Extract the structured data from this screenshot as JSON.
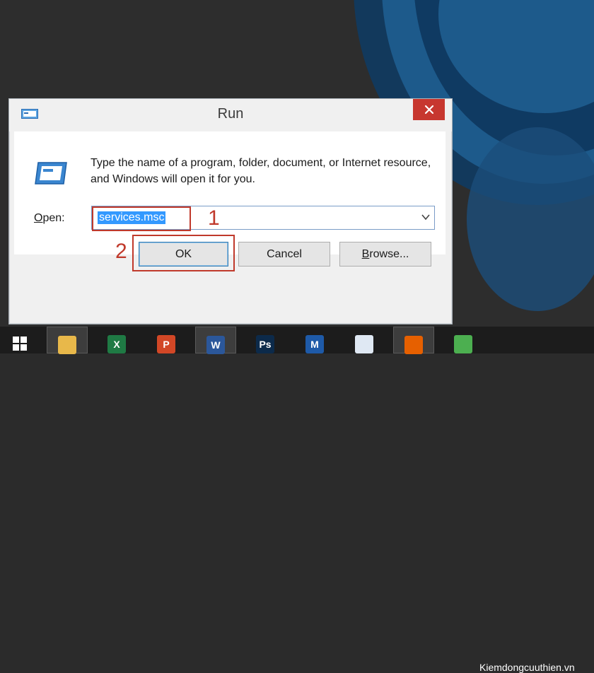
{
  "dialog": {
    "title": "Run",
    "description": "Type the name of a program, folder, document, or Internet resource, and Windows will open it for you.",
    "open_label_accel": "O",
    "open_label_rest": "pen:",
    "open_value": "services.msc",
    "buttons": {
      "ok": "OK",
      "cancel": "Cancel",
      "browse_accel": "B",
      "browse_rest": "rowse..."
    }
  },
  "annotations": {
    "step1": "1",
    "step2": "2",
    "color": "#c0392b"
  },
  "taskbar": {
    "items": [
      {
        "name": "file-explorer-icon",
        "glyph": "",
        "color": "#e8b84a"
      },
      {
        "name": "excel-icon",
        "glyph": "X",
        "color": "#1f7a44"
      },
      {
        "name": "powerpoint-icon",
        "glyph": "P",
        "color": "#d24726"
      },
      {
        "name": "word-icon",
        "glyph": "W",
        "color": "#2b579a"
      },
      {
        "name": "photoshop-icon",
        "glyph": "Ps",
        "color": "#0c2a4a"
      },
      {
        "name": "m-app-icon",
        "glyph": "M",
        "color": "#1e5aa8"
      },
      {
        "name": "document-icon",
        "glyph": "",
        "color": "#dfe8f3"
      },
      {
        "name": "firefox-icon",
        "glyph": "",
        "color": "#e66000"
      },
      {
        "name": "chrome-icon",
        "glyph": "",
        "color": "#4caf50"
      }
    ]
  },
  "watermark": "Kiemdongcuuthien.vn"
}
